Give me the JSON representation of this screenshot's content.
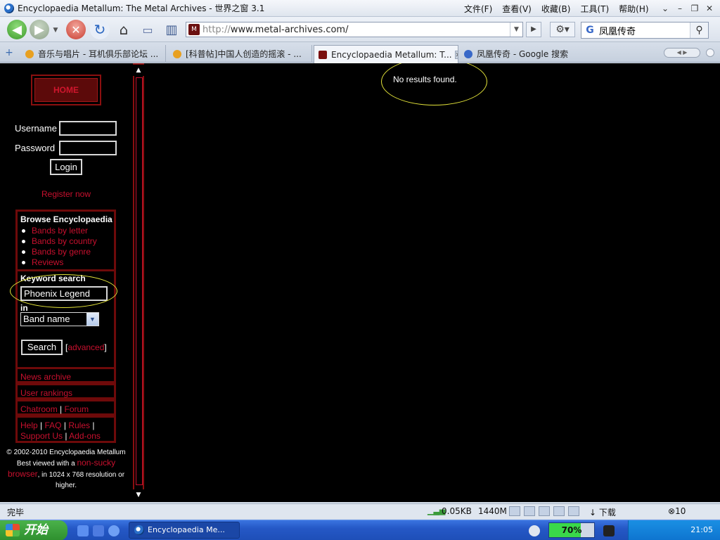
{
  "window": {
    "title": "Encyclopaedia Metallum: The Metal Archives - 世界之窗 3.1",
    "menus": [
      "文件(F)",
      "查看(V)",
      "收藏(B)",
      "工具(T)",
      "帮助(H)"
    ]
  },
  "toolbar": {
    "url_protocol": "http://",
    "url_host": "www.metal-archives.com/",
    "favicon_text": "M",
    "search_value": "凤凰传奇"
  },
  "tabs": [
    {
      "label": "音乐与唱片 - 耳机俱乐部论坛 ...",
      "icon_color": "#e8a020"
    },
    {
      "label": "[科普帖]中国人创造的摇滚 - ...",
      "icon_color": "#e8a020"
    },
    {
      "label": "Encyclopaedia Metallum: T...",
      "icon_color": "#7a1010"
    },
    {
      "label": "凤凰传奇 - Google 搜索",
      "icon_color": "#3868c8"
    }
  ],
  "sidebar": {
    "home": "HOME",
    "username_label": "Username",
    "password_label": "Password",
    "login": "Login",
    "register": "Register now",
    "browse_title": "Browse Encyclopaedia",
    "browse_links": [
      "Bands by letter",
      "Bands by country",
      "Bands by genre",
      "Reviews"
    ],
    "keyword_title": "Keyword search",
    "keyword_value": "Phoenix Legend",
    "in_label": "in",
    "select_value": "Band name",
    "search_button": "Search",
    "advanced": "advanced",
    "news": "News archive",
    "rankings": "User rankings",
    "chatroom": "Chatroom",
    "forum": "Forum",
    "help": "Help",
    "faq": "FAQ",
    "rules": "Rules",
    "support": "Support Us",
    "addons": "Add-ons",
    "copyright": "© 2002-2010 Encyclopaedia Metallum",
    "best_viewed_pre": "Best viewed with a",
    "best_viewed_link": "non-sucky browser",
    "best_viewed_post": ", in 1024 x 768 resolution or higher."
  },
  "main": {
    "message": "No results found."
  },
  "statusbar": {
    "status": "完毕",
    "data": "0.05KB",
    "memory": "1440M",
    "download": "下载",
    "count": "10"
  },
  "taskbar": {
    "start": "开始",
    "task": "Encyclopaedia Me...",
    "battery": "70%",
    "clock": "21:05"
  }
}
